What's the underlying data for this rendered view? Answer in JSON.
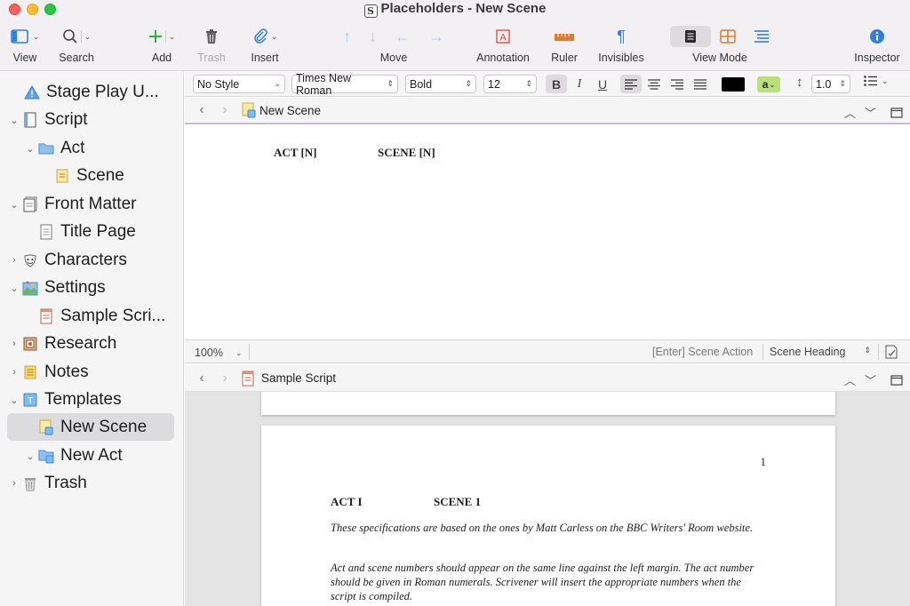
{
  "window": {
    "title": "Placeholders - New Scene"
  },
  "toolbar": {
    "view": "View",
    "search": "Search",
    "add": "Add",
    "trash": "Trash",
    "insert": "Insert",
    "move": "Move",
    "annotation": "Annotation",
    "ruler": "Ruler",
    "invisibles": "Invisibles",
    "view_mode": "View Mode",
    "inspector": "Inspector"
  },
  "binder": {
    "items": [
      {
        "label": "Stage Play U...",
        "icon": "warning-icon"
      },
      {
        "label": "Script",
        "icon": "script-icon"
      },
      {
        "label": "Act",
        "icon": "folder-icon"
      },
      {
        "label": "Scene",
        "icon": "scene-icon"
      },
      {
        "label": "Front Matter",
        "icon": "front-matter-icon"
      },
      {
        "label": "Title Page",
        "icon": "document-icon"
      },
      {
        "label": "Characters",
        "icon": "mask-icon"
      },
      {
        "label": "Settings",
        "icon": "settings-icon"
      },
      {
        "label": "Sample Scri...",
        "icon": "sample-script-icon"
      },
      {
        "label": "Research",
        "icon": "research-icon"
      },
      {
        "label": "Notes",
        "icon": "notes-icon"
      },
      {
        "label": "Templates",
        "icon": "templates-icon"
      },
      {
        "label": "New Scene",
        "icon": "template-scene-icon",
        "selected": true
      },
      {
        "label": "New Act",
        "icon": "template-act-icon"
      },
      {
        "label": "Trash",
        "icon": "trash-icon"
      }
    ]
  },
  "format": {
    "style": "No Style",
    "font": "Times New Roman",
    "weight": "Bold",
    "size": "12",
    "bold": "B",
    "italic": "I",
    "underline": "U",
    "highlight": "a",
    "line_spacing": "1.0",
    "text_color": "#000000",
    "highlight_color": "#b7e27a"
  },
  "top_editor": {
    "doc_title": "New Scene",
    "act_heading": "ACT [N]",
    "scene_heading": "SCENE [N]",
    "zoom": "100%",
    "hint": "[Enter] Scene Action",
    "element": "Scene Heading"
  },
  "bottom_editor": {
    "doc_title": "Sample Script",
    "page_number": "1",
    "act": "ACT I",
    "scene": "SCENE 1",
    "para1": "These specifications are based on the ones by Matt Carless on the BBC Writers' Room website.",
    "para2": "Act and scene numbers should appear on the same line against the left margin. The act number should be given in Roman numerals. Scrivener will insert the appropriate numbers when the script is compiled."
  },
  "colors": {
    "accent": "#3b82e0",
    "add_green": "#3aa74a",
    "orange": "#e07a2c",
    "header_purple_line": "#c9b8e0",
    "selection": "#dcdbde"
  }
}
